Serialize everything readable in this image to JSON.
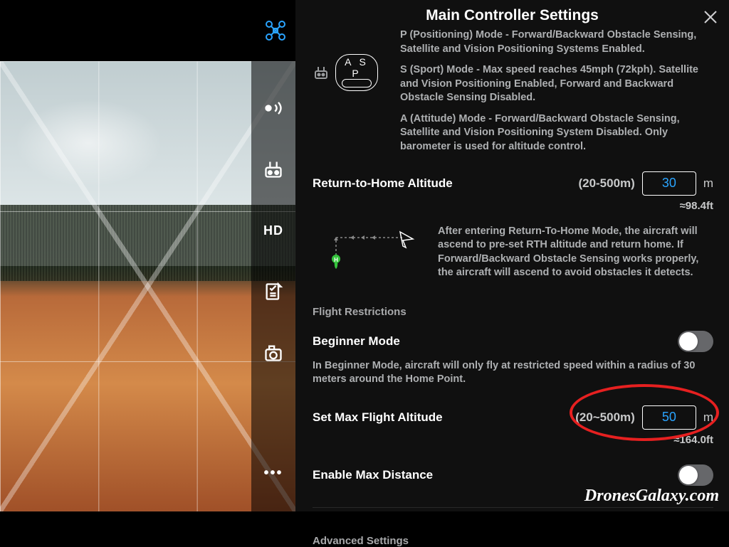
{
  "panel": {
    "title": "Main Controller Settings",
    "modes": {
      "asp_label": "A S P",
      "p": "P (Positioning) Mode - Forward/Backward Obstacle Sensing, Satellite and Vision Positioning Systems Enabled.",
      "s": "S (Sport) Mode - Max speed reaches 45mph (72kph). Satellite and Vision Positioning Enabled, Forward and Backward Obstacle Sensing Disabled.",
      "a": "A (Attitude) Mode - Forward/Backward Obstacle Sensing, Satellite and Vision Positioning System Disabled. Only barometer is used for altitude control."
    },
    "rth": {
      "label": "Return-to-Home Altitude",
      "range": "(20-500m)",
      "value": "30",
      "unit": "m",
      "ft": "≈98.4ft",
      "desc": "After entering Return-To-Home Mode, the aircraft will ascend to pre-set RTH altitude and return home. If Forward/Backward Obstacle Sensing works properly, the aircraft will ascend to avoid obstacles it detects."
    },
    "restrictions_head": "Flight Restrictions",
    "beginner": {
      "label": "Beginner Mode",
      "desc": "In Beginner Mode, aircraft will only fly at restricted speed within a radius of 30 meters around the Home Point."
    },
    "maxalt": {
      "label": "Set Max Flight Altitude",
      "range": "(20~500m)",
      "value": "50",
      "unit": "m",
      "ft": "≈164.0ft"
    },
    "maxdist": {
      "label": "Enable Max Distance"
    },
    "advanced": "Advanced Settings"
  },
  "sidebar": {
    "hd": "HD",
    "more": "•••"
  },
  "watermark": "DronesGalaxy.com"
}
